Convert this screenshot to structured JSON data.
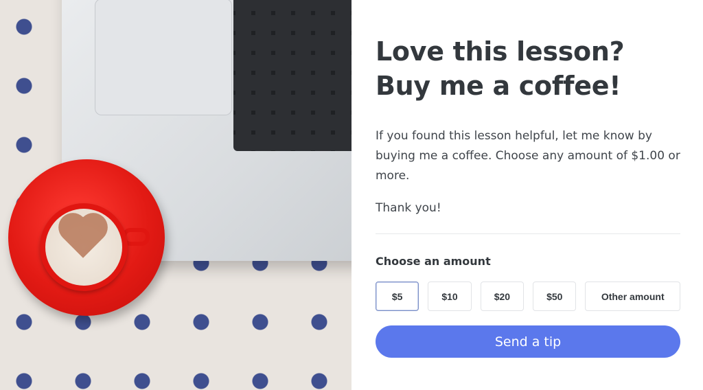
{
  "card": {
    "title_line1": "Love this lesson?",
    "title_line2": "Buy me a coffee!",
    "description": "If you found this lesson helpful, let me know by buying me a coffee. Choose any amount of $1.00 or more.",
    "thanks": "Thank you!",
    "choose_label": "Choose an amount",
    "amounts": [
      "$5",
      "$10",
      "$20",
      "$50",
      "Other amount"
    ],
    "selected_amount": "$5",
    "send_button": "Send a tip"
  },
  "colors": {
    "accent": "#5b78ec",
    "title": "#33383d",
    "saucer": "#e21a14",
    "dots": "#3f4f8f"
  }
}
